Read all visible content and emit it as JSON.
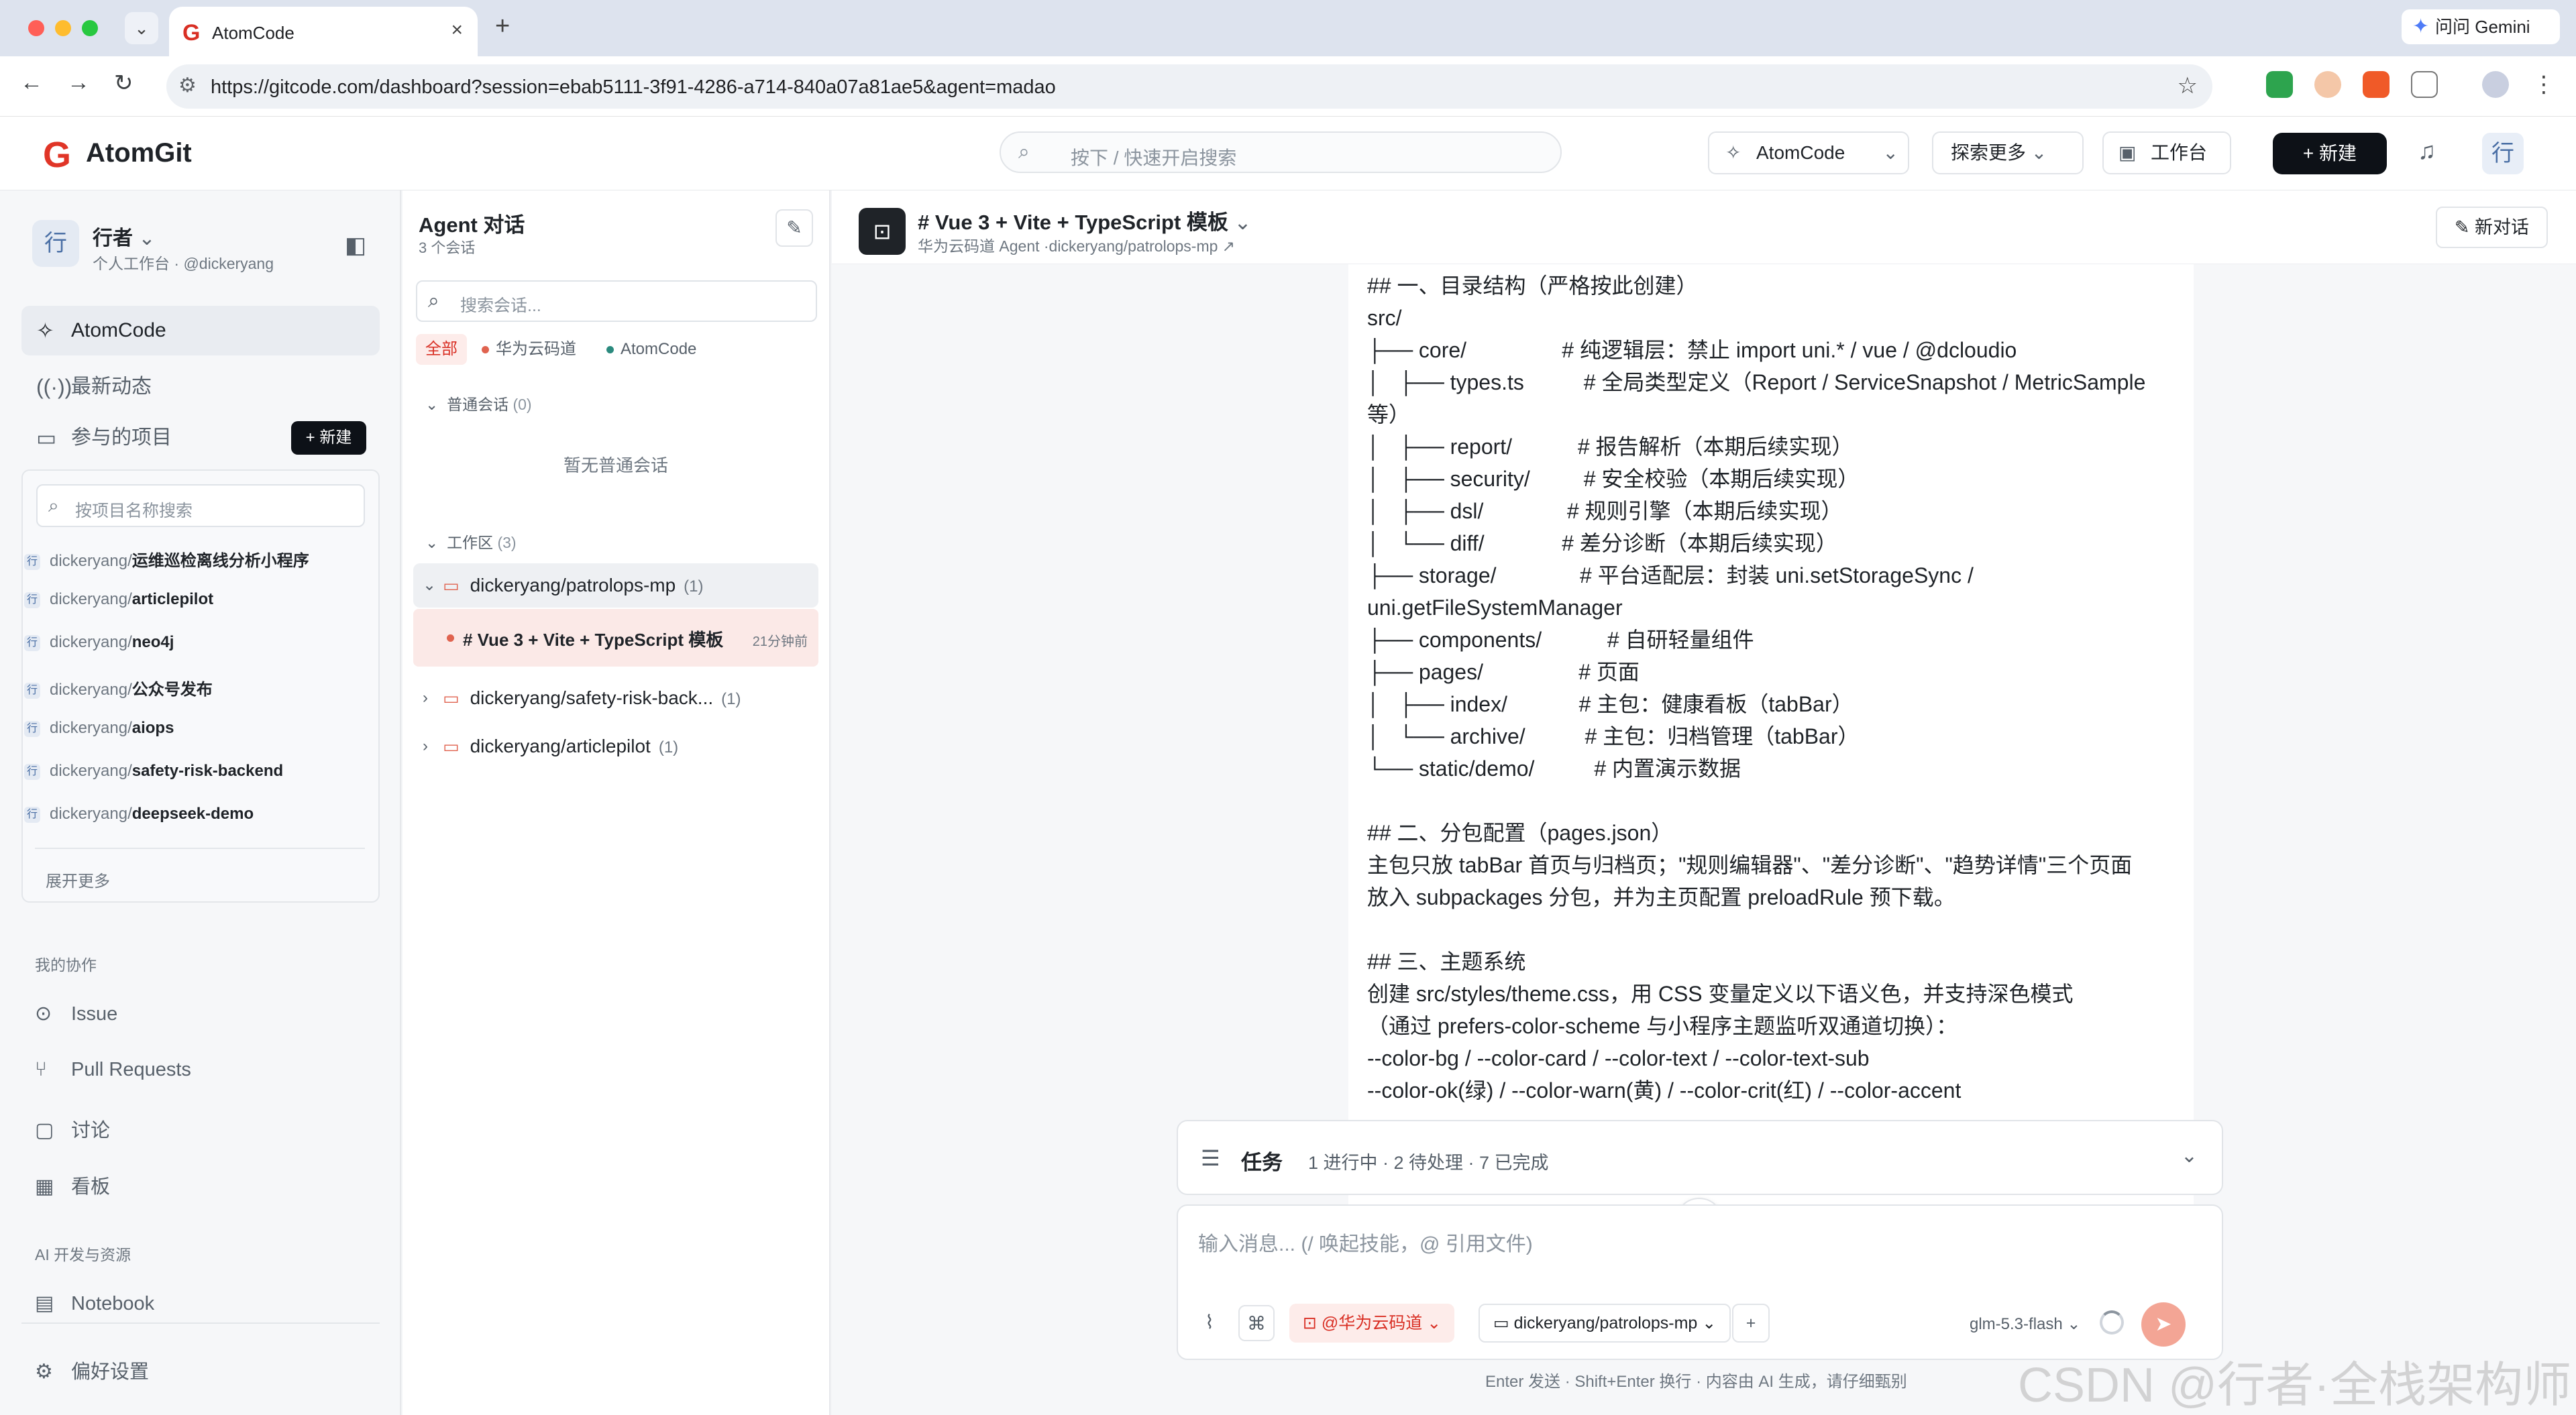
{
  "browser": {
    "tab_title": "AtomCode",
    "url": "https://gitcode.com/dashboard?session=ebab5111-3f91-4286-a714-840a07a81ae5&agent=madao",
    "gemini_label": "问问 Gemini"
  },
  "header": {
    "logo": "AtomGit",
    "search_placeholder": "按下 / 快速开启搜索",
    "atomcode_btn": "AtomCode",
    "explore_btn": "探索更多",
    "workbench_btn": "工作台",
    "new_btn": "+ 新建",
    "avatar": "行"
  },
  "sidebar": {
    "workspace_avatar": "行",
    "workspace_name": "行者",
    "workspace_sub": "个人工作台 · @dickeryang",
    "nav": [
      {
        "label": "AtomCode"
      },
      {
        "label": "最新动态"
      },
      {
        "label": "参与的项目"
      }
    ],
    "new_btn": "+ 新建",
    "project_search_placeholder": "按项目名称搜索",
    "projects": [
      {
        "owner": "dickeryang/",
        "name": "运维巡检离线分析小程序"
      },
      {
        "owner": "dickeryang/",
        "name": "articlepilot"
      },
      {
        "owner": "dickeryang/",
        "name": "neo4j"
      },
      {
        "owner": "dickeryang/",
        "name": "公众号发布"
      },
      {
        "owner": "dickeryang/",
        "name": "aiops"
      },
      {
        "owner": "dickeryang/",
        "name": "safety-risk-backend"
      },
      {
        "owner": "dickeryang/",
        "name": "deepseek-demo"
      }
    ],
    "expand_more": "展开更多",
    "collab_section": "我的协作",
    "collab_items": [
      "Issue",
      "Pull Requests",
      "讨论",
      "看板"
    ],
    "ai_section": "AI 开发与资源",
    "ai_items": [
      "Notebook"
    ],
    "settings": "偏好设置"
  },
  "conversations": {
    "title": "Agent 对话",
    "count": "3 个会话",
    "search_placeholder": "搜索会话...",
    "filters": [
      "全部",
      "华为云码道",
      "AtomCode"
    ],
    "normal_group": "普通会话",
    "normal_group_count": "(0)",
    "empty_note": "暂无普通会话",
    "workspace_group": "工作区",
    "workspace_group_count": "(3)",
    "repos": [
      {
        "name": "dickeryang/patrolops-mp",
        "count": "(1)"
      },
      {
        "name": "dickeryang/safety-risk-back...",
        "count": "(1)"
      },
      {
        "name": "dickeryang/articlepilot",
        "count": "(1)"
      }
    ],
    "active_conv": {
      "title": "# Vue 3 + Vite + TypeScript 模板",
      "time": "21分钟前"
    }
  },
  "main": {
    "title": "# Vue 3 + Vite + TypeScript 模板",
    "subtitle": "华为云码道 Agent ·dickeryang/patrolops-mp ↗",
    "new_chat": "新对话",
    "content_lines": [
      "## 一、目录结构（严格按此创建）",
      "src/",
      "├── core/                # 纯逻辑层：禁止 import uni.* / vue / @dcloudio",
      "│   ├── types.ts          # 全局类型定义（Report / ServiceSnapshot / MetricSample",
      "等）",
      "│   ├── report/           # 报告解析（本期后续实现）",
      "│   ├── security/         # 安全校验（本期后续实现）",
      "│   ├── dsl/              # 规则引擎（本期后续实现）",
      "│   └── diff/             # 差分诊断（本期后续实现）",
      "├── storage/              # 平台适配层：封装 uni.setStorageSync /",
      "uni.getFileSystemManager",
      "├── components/           # 自研轻量组件",
      "├── pages/                # 页面",
      "│   ├── index/            # 主包：健康看板（tabBar）",
      "│   └── archive/          # 主包：归档管理（tabBar）",
      "└── static/demo/          # 内置演示数据",
      "",
      "## 二、分包配置（pages.json）",
      "主包只放 tabBar 首页与归档页；\"规则编辑器\"、\"差分诊断\"、\"趋势详情\"三个页面",
      "放入 subpackages 分包，并为主页配置 preloadRule 预下载。",
      "",
      "## 三、主题系统",
      "创建 src/styles/theme.css，用 CSS 变量定义以下语义色，并支持深色模式",
      "（通过 prefers-color-scheme 与小程序主题监听双通道切换）：",
      "--color-bg / --color-card / --color-text / --color-text-sub",
      "--color-ok(绿) / --color-warn(黄) / --color-crit(红) / --color-accent"
    ],
    "task_label": "任务",
    "task_status": "1 进行中 · 2 待处理 · 7 已完成",
    "input_placeholder": "输入消息...  (/ 唤起技能，@ 引用文件)",
    "agent_chip": "@华为云码道",
    "repo_chip": "dickeryang/patrolops-mp",
    "model": "glm-5.3-flash",
    "footer": "Enter 发送 · Shift+Enter 换行 · 内容由 AI 生成，请仔细甄别",
    "watermark": "CSDN @行者·全栈架构师"
  },
  "colors": {
    "brand": "#e03527",
    "accent": "#d93025"
  }
}
